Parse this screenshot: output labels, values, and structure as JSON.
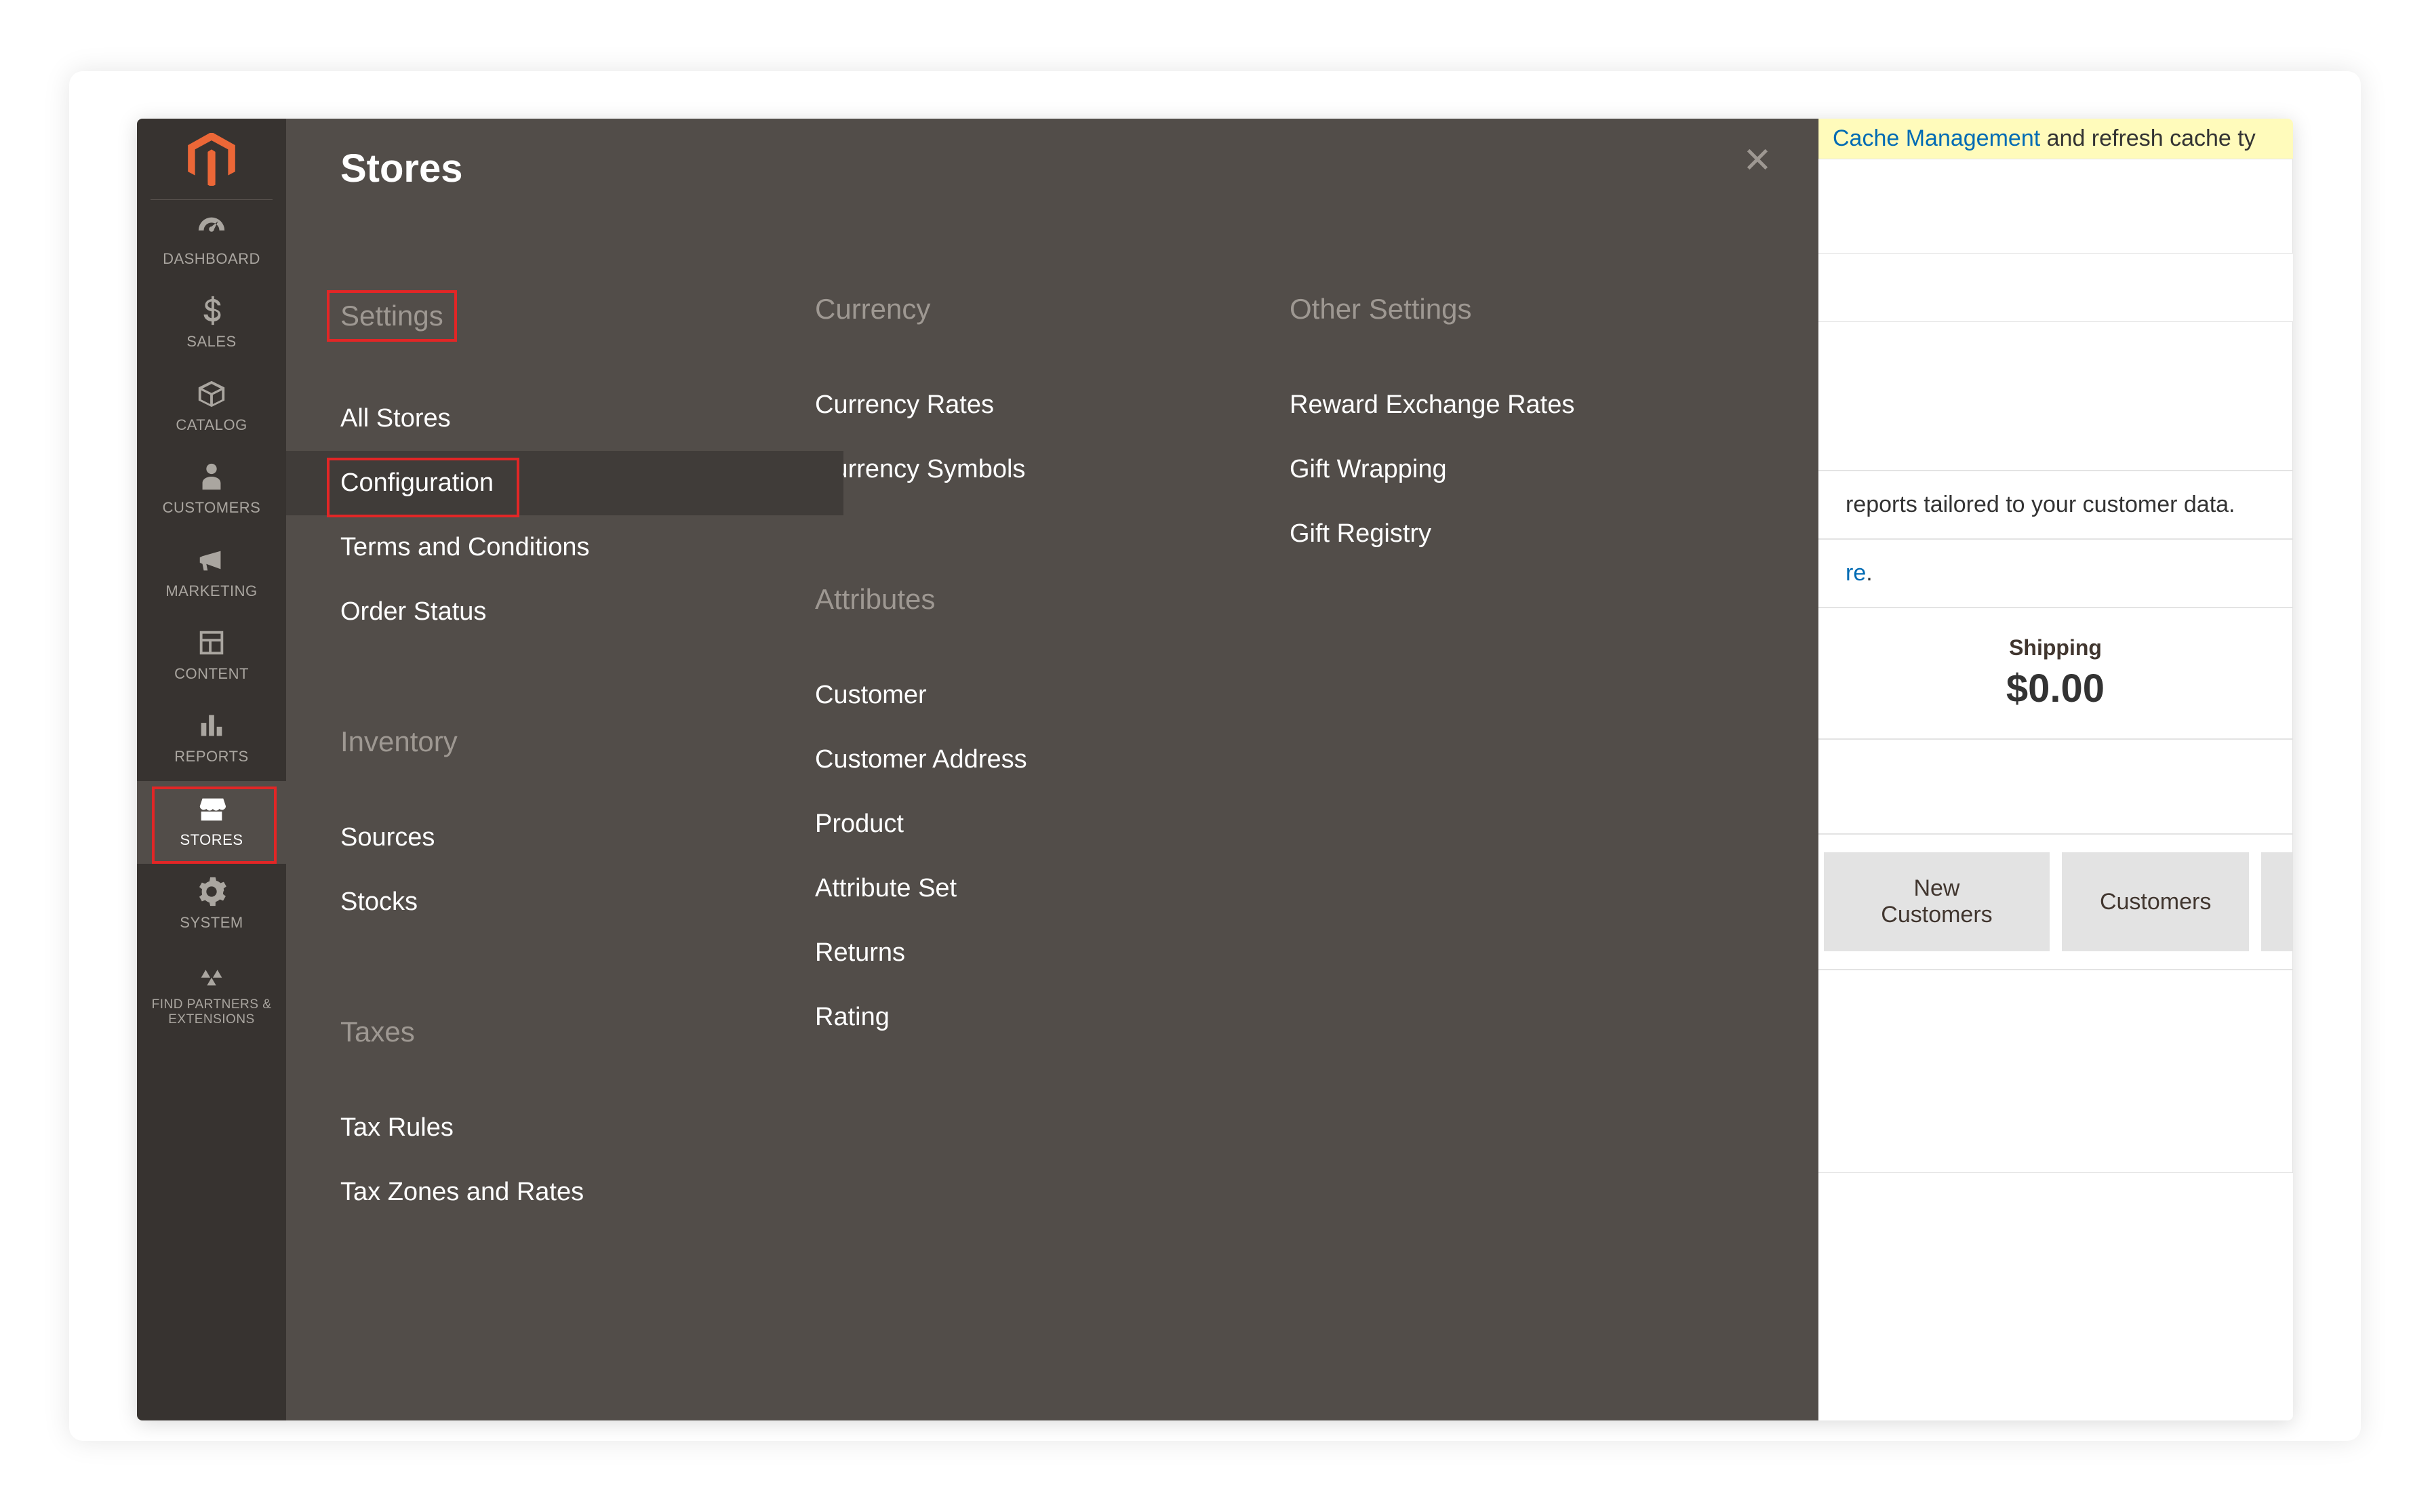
{
  "sidebar": [
    {
      "id": "dashboard",
      "label": "DASHBOARD"
    },
    {
      "id": "sales",
      "label": "SALES"
    },
    {
      "id": "catalog",
      "label": "CATALOG"
    },
    {
      "id": "customers",
      "label": "CUSTOMERS"
    },
    {
      "id": "marketing",
      "label": "MARKETING"
    },
    {
      "id": "content",
      "label": "CONTENT"
    },
    {
      "id": "reports",
      "label": "REPORTS"
    },
    {
      "id": "stores",
      "label": "STORES"
    },
    {
      "id": "system",
      "label": "SYSTEM"
    },
    {
      "id": "partners",
      "label": "FIND PARTNERS & EXTENSIONS"
    }
  ],
  "flyout": {
    "title": "Stores",
    "columns": [
      {
        "groups": [
          {
            "header": "Settings",
            "highlighted": true,
            "items": [
              "All Stores",
              "Configuration",
              "Terms and Conditions",
              "Order Status"
            ],
            "activeIndex": 1
          },
          {
            "header": "Inventory",
            "items": [
              "Sources",
              "Stocks"
            ]
          },
          {
            "header": "Taxes",
            "items": [
              "Tax Rules",
              "Tax Zones and Rates"
            ]
          }
        ]
      },
      {
        "groups": [
          {
            "header": "Currency",
            "items": [
              "Currency Rates",
              "Currency Symbols"
            ]
          },
          {
            "header": "Attributes",
            "items": [
              "Customer",
              "Customer Address",
              "Product",
              "Attribute Set",
              "Returns",
              "Rating"
            ]
          }
        ]
      },
      {
        "groups": [
          {
            "header": "Other Settings",
            "items": [
              "Reward Exchange Rates",
              "Gift Wrapping",
              "Gift Registry"
            ]
          }
        ]
      }
    ]
  },
  "background": {
    "notice_link": "Cache Management",
    "notice_suffix": " and refresh cache ty",
    "bi_text": "reports tailored to your customer data.",
    "here": "re",
    "here_suffix": ".",
    "stat_label": "Shipping",
    "stat_value": "$0.00",
    "tab1": "New Customers",
    "tab2": "Customers"
  }
}
